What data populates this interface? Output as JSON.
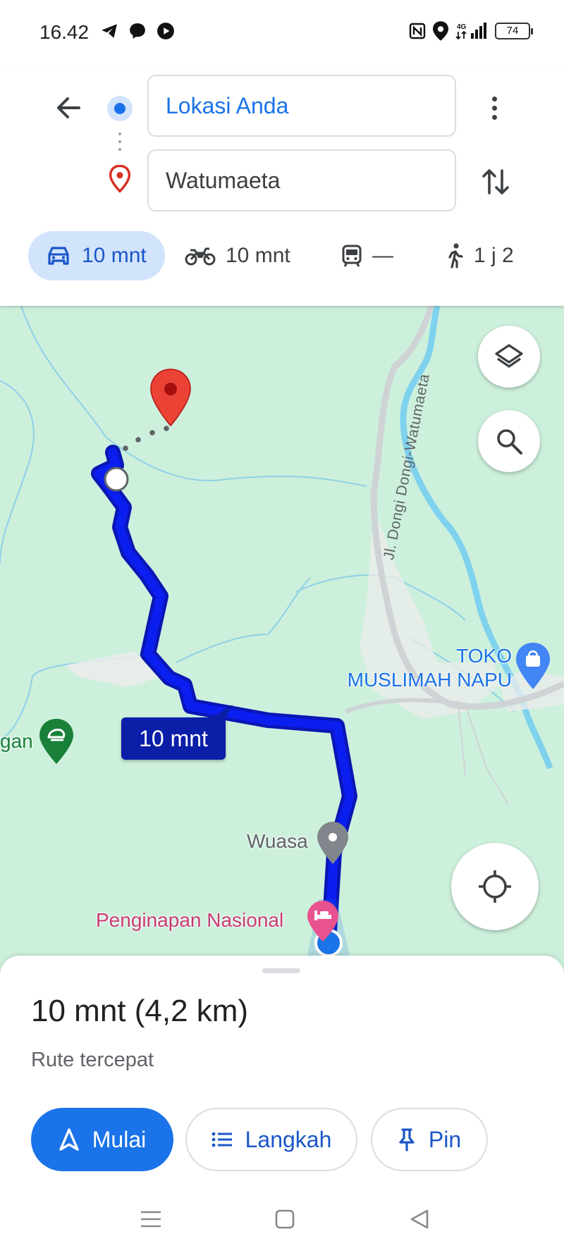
{
  "status_bar": {
    "time": "16.42",
    "app_icons": [
      "telegram-icon",
      "messenger-icon",
      "youtube-icon"
    ],
    "right_icons": [
      "nfc-icon",
      "location-icon",
      "signal-4g-icon"
    ],
    "battery": "74"
  },
  "directions": {
    "origin": "Lokasi Anda",
    "destination": "Watumaeta"
  },
  "modes": [
    {
      "icon": "car-icon",
      "label": "10 mnt",
      "selected": true
    },
    {
      "icon": "motorcycle-icon",
      "label": "10 mnt",
      "selected": false
    },
    {
      "icon": "transit-icon",
      "label": "—",
      "selected": false
    },
    {
      "icon": "walk-icon",
      "label": "1 j 2",
      "selected": false
    }
  ],
  "map": {
    "road_name": "Jl. Dongi Dongi-Watumaeta",
    "places": {
      "toko": "TOKO\nMUSLIMAH NAPU",
      "wuasa": "Wuasa",
      "penginapan": "Penginapan Nasional",
      "gan": "gan"
    },
    "route_time_chip": "10 mnt",
    "colors": {
      "land": "#cdf0dc",
      "route": "#0a1ef0",
      "route_outline": "#0a16b5",
      "water": "#8fd8f0",
      "destination_pin": "#ea4335"
    }
  },
  "sheet": {
    "summary": "10 mnt (4,2 km)",
    "subtitle": "Rute tercepat",
    "start_label": "Mulai",
    "steps_label": "Langkah",
    "pin_label": "Pin"
  },
  "accent_color": "#1a73e8"
}
